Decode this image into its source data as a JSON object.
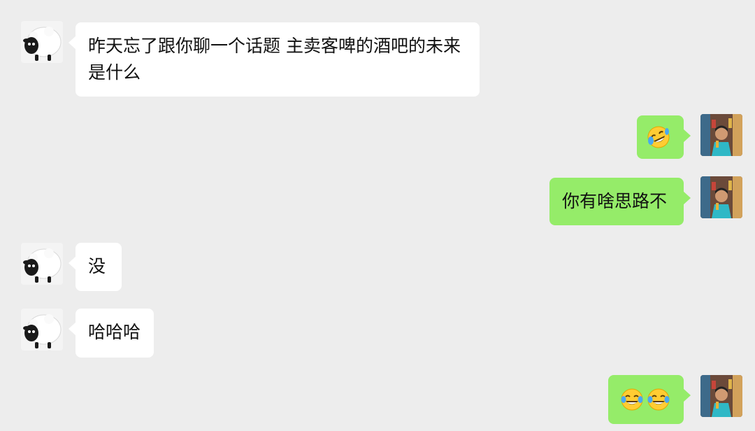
{
  "messages": [
    {
      "side": "left",
      "text": "昨天忘了跟你聊一个话题  主卖客啤的酒吧的未来是什么"
    },
    {
      "side": "right",
      "emoji": [
        "face-with-tears-of-joy-tilted"
      ]
    },
    {
      "side": "right",
      "text": "你有啥思路不"
    },
    {
      "side": "left",
      "text": "没"
    },
    {
      "side": "left",
      "text": "哈哈哈"
    },
    {
      "side": "right",
      "emoji": [
        "face-with-tears-of-joy",
        "face-with-tears-of-joy"
      ]
    }
  ],
  "avatars": {
    "left": "sheep-avatar",
    "right": "person-photo-avatar"
  },
  "colors": {
    "background": "#EDEDED",
    "incoming_bubble": "#FFFFFF",
    "outgoing_bubble": "#95EC69"
  }
}
